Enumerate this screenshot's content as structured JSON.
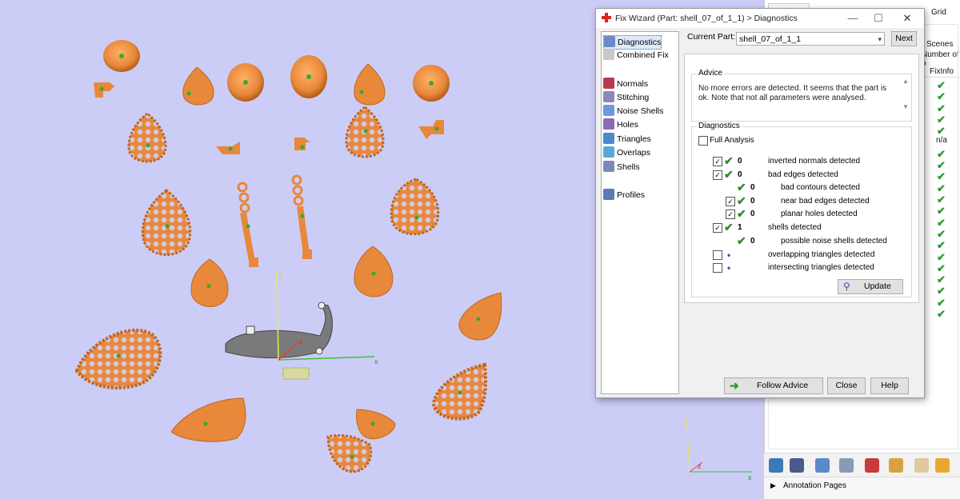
{
  "dialog": {
    "title": "Fix Wizard (Part: shell_07_of_1_1) > Diagnostics",
    "nav": [
      {
        "label": "Diagnostics",
        "icon": "magnifier-icon",
        "selected": true
      },
      {
        "label": "Combined Fix",
        "icon": "combined-fix-icon"
      },
      {
        "label": "Normals",
        "icon": "normals-cube-icon"
      },
      {
        "label": "Stitching",
        "icon": "stitching-icon"
      },
      {
        "label": "Noise Shells",
        "icon": "noise-shells-icon"
      },
      {
        "label": "Holes",
        "icon": "holes-cube-icon"
      },
      {
        "label": "Triangles",
        "icon": "triangles-icon"
      },
      {
        "label": "Overlaps",
        "icon": "overlaps-icon"
      },
      {
        "label": "Shells",
        "icon": "shells-icon"
      },
      {
        "label": "Profiles",
        "icon": "profiles-document-icon"
      }
    ],
    "current_part_label": "Current Part:",
    "current_part_value": "shell_07_of_1_1",
    "next_label": "Next",
    "advice_heading": "Advice",
    "advice_text": "No more errors are detected. It seems that the part is ok. Note that not all parameters were analysed.",
    "diagnostics_heading": "Diagnostics",
    "full_analysis_label": "Full Analysis",
    "rows": [
      {
        "label": "inverted normals detected",
        "count": "0",
        "checked": true,
        "status": "ok",
        "indent": 0
      },
      {
        "label": "bad edges detected",
        "count": "0",
        "checked": true,
        "status": "ok",
        "indent": 0
      },
      {
        "label": "bad contours detected",
        "count": "0",
        "checked": null,
        "status": "ok",
        "indent": 1
      },
      {
        "label": "near bad edges detected",
        "count": "0",
        "checked": true,
        "status": "ok",
        "indent": 1
      },
      {
        "label": "planar holes detected",
        "count": "0",
        "checked": true,
        "status": "ok",
        "indent": 1
      },
      {
        "label": "shells detected",
        "count": "1",
        "checked": true,
        "status": "ok",
        "indent": 0
      },
      {
        "label": "possible noise shells detected",
        "count": "0",
        "checked": null,
        "status": "ok",
        "indent": 1
      },
      {
        "label": "overlapping triangles detected",
        "count": "",
        "checked": false,
        "status": "pending",
        "indent": 0
      },
      {
        "label": "intersecting triangles detected",
        "count": "",
        "checked": false,
        "status": "pending",
        "indent": 0
      }
    ],
    "update_label": "Update",
    "follow_advice_label": "Follow Advice",
    "close_label": "Close",
    "help_label": "Help"
  },
  "right_panel": {
    "tab_label": "Grid",
    "scenes_label": "Scenes",
    "number_label": "Number of p",
    "fixinfo_label": "FixInfo",
    "na_label": "n/a",
    "annotation_label": "Annotation Pages"
  },
  "viewport": {
    "axis_x_label": "x",
    "axis_y_label": "y",
    "axis_z_label": "z",
    "background_color": "#cccdf7",
    "part_color": "#e8883a"
  }
}
